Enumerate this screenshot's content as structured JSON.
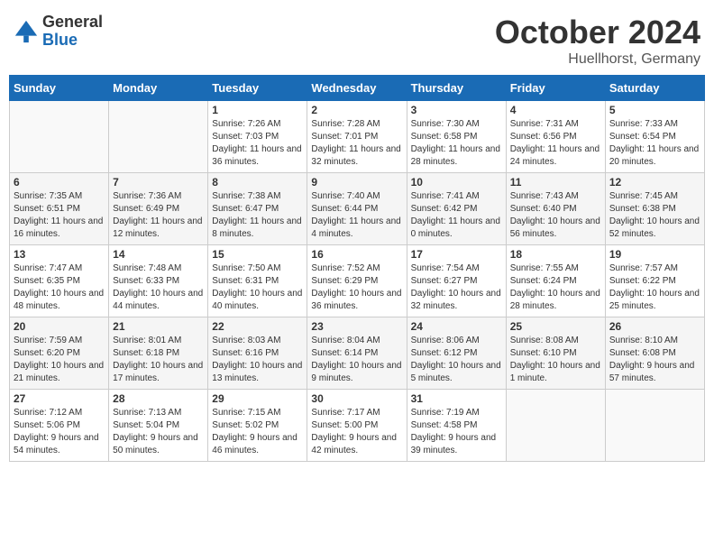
{
  "header": {
    "logo_general": "General",
    "logo_blue": "Blue",
    "title": "October 2024",
    "location": "Huellhorst, Germany"
  },
  "weekdays": [
    "Sunday",
    "Monday",
    "Tuesday",
    "Wednesday",
    "Thursday",
    "Friday",
    "Saturday"
  ],
  "weeks": [
    [
      {
        "day": "",
        "sunrise": "",
        "sunset": "",
        "daylight": ""
      },
      {
        "day": "",
        "sunrise": "",
        "sunset": "",
        "daylight": ""
      },
      {
        "day": "1",
        "sunrise": "Sunrise: 7:26 AM",
        "sunset": "Sunset: 7:03 PM",
        "daylight": "Daylight: 11 hours and 36 minutes."
      },
      {
        "day": "2",
        "sunrise": "Sunrise: 7:28 AM",
        "sunset": "Sunset: 7:01 PM",
        "daylight": "Daylight: 11 hours and 32 minutes."
      },
      {
        "day": "3",
        "sunrise": "Sunrise: 7:30 AM",
        "sunset": "Sunset: 6:58 PM",
        "daylight": "Daylight: 11 hours and 28 minutes."
      },
      {
        "day": "4",
        "sunrise": "Sunrise: 7:31 AM",
        "sunset": "Sunset: 6:56 PM",
        "daylight": "Daylight: 11 hours and 24 minutes."
      },
      {
        "day": "5",
        "sunrise": "Sunrise: 7:33 AM",
        "sunset": "Sunset: 6:54 PM",
        "daylight": "Daylight: 11 hours and 20 minutes."
      }
    ],
    [
      {
        "day": "6",
        "sunrise": "Sunrise: 7:35 AM",
        "sunset": "Sunset: 6:51 PM",
        "daylight": "Daylight: 11 hours and 16 minutes."
      },
      {
        "day": "7",
        "sunrise": "Sunrise: 7:36 AM",
        "sunset": "Sunset: 6:49 PM",
        "daylight": "Daylight: 11 hours and 12 minutes."
      },
      {
        "day": "8",
        "sunrise": "Sunrise: 7:38 AM",
        "sunset": "Sunset: 6:47 PM",
        "daylight": "Daylight: 11 hours and 8 minutes."
      },
      {
        "day": "9",
        "sunrise": "Sunrise: 7:40 AM",
        "sunset": "Sunset: 6:44 PM",
        "daylight": "Daylight: 11 hours and 4 minutes."
      },
      {
        "day": "10",
        "sunrise": "Sunrise: 7:41 AM",
        "sunset": "Sunset: 6:42 PM",
        "daylight": "Daylight: 11 hours and 0 minutes."
      },
      {
        "day": "11",
        "sunrise": "Sunrise: 7:43 AM",
        "sunset": "Sunset: 6:40 PM",
        "daylight": "Daylight: 10 hours and 56 minutes."
      },
      {
        "day": "12",
        "sunrise": "Sunrise: 7:45 AM",
        "sunset": "Sunset: 6:38 PM",
        "daylight": "Daylight: 10 hours and 52 minutes."
      }
    ],
    [
      {
        "day": "13",
        "sunrise": "Sunrise: 7:47 AM",
        "sunset": "Sunset: 6:35 PM",
        "daylight": "Daylight: 10 hours and 48 minutes."
      },
      {
        "day": "14",
        "sunrise": "Sunrise: 7:48 AM",
        "sunset": "Sunset: 6:33 PM",
        "daylight": "Daylight: 10 hours and 44 minutes."
      },
      {
        "day": "15",
        "sunrise": "Sunrise: 7:50 AM",
        "sunset": "Sunset: 6:31 PM",
        "daylight": "Daylight: 10 hours and 40 minutes."
      },
      {
        "day": "16",
        "sunrise": "Sunrise: 7:52 AM",
        "sunset": "Sunset: 6:29 PM",
        "daylight": "Daylight: 10 hours and 36 minutes."
      },
      {
        "day": "17",
        "sunrise": "Sunrise: 7:54 AM",
        "sunset": "Sunset: 6:27 PM",
        "daylight": "Daylight: 10 hours and 32 minutes."
      },
      {
        "day": "18",
        "sunrise": "Sunrise: 7:55 AM",
        "sunset": "Sunset: 6:24 PM",
        "daylight": "Daylight: 10 hours and 28 minutes."
      },
      {
        "day": "19",
        "sunrise": "Sunrise: 7:57 AM",
        "sunset": "Sunset: 6:22 PM",
        "daylight": "Daylight: 10 hours and 25 minutes."
      }
    ],
    [
      {
        "day": "20",
        "sunrise": "Sunrise: 7:59 AM",
        "sunset": "Sunset: 6:20 PM",
        "daylight": "Daylight: 10 hours and 21 minutes."
      },
      {
        "day": "21",
        "sunrise": "Sunrise: 8:01 AM",
        "sunset": "Sunset: 6:18 PM",
        "daylight": "Daylight: 10 hours and 17 minutes."
      },
      {
        "day": "22",
        "sunrise": "Sunrise: 8:03 AM",
        "sunset": "Sunset: 6:16 PM",
        "daylight": "Daylight: 10 hours and 13 minutes."
      },
      {
        "day": "23",
        "sunrise": "Sunrise: 8:04 AM",
        "sunset": "Sunset: 6:14 PM",
        "daylight": "Daylight: 10 hours and 9 minutes."
      },
      {
        "day": "24",
        "sunrise": "Sunrise: 8:06 AM",
        "sunset": "Sunset: 6:12 PM",
        "daylight": "Daylight: 10 hours and 5 minutes."
      },
      {
        "day": "25",
        "sunrise": "Sunrise: 8:08 AM",
        "sunset": "Sunset: 6:10 PM",
        "daylight": "Daylight: 10 hours and 1 minute."
      },
      {
        "day": "26",
        "sunrise": "Sunrise: 8:10 AM",
        "sunset": "Sunset: 6:08 PM",
        "daylight": "Daylight: 9 hours and 57 minutes."
      }
    ],
    [
      {
        "day": "27",
        "sunrise": "Sunrise: 7:12 AM",
        "sunset": "Sunset: 5:06 PM",
        "daylight": "Daylight: 9 hours and 54 minutes."
      },
      {
        "day": "28",
        "sunrise": "Sunrise: 7:13 AM",
        "sunset": "Sunset: 5:04 PM",
        "daylight": "Daylight: 9 hours and 50 minutes."
      },
      {
        "day": "29",
        "sunrise": "Sunrise: 7:15 AM",
        "sunset": "Sunset: 5:02 PM",
        "daylight": "Daylight: 9 hours and 46 minutes."
      },
      {
        "day": "30",
        "sunrise": "Sunrise: 7:17 AM",
        "sunset": "Sunset: 5:00 PM",
        "daylight": "Daylight: 9 hours and 42 minutes."
      },
      {
        "day": "31",
        "sunrise": "Sunrise: 7:19 AM",
        "sunset": "Sunset: 4:58 PM",
        "daylight": "Daylight: 9 hours and 39 minutes."
      },
      {
        "day": "",
        "sunrise": "",
        "sunset": "",
        "daylight": ""
      },
      {
        "day": "",
        "sunrise": "",
        "sunset": "",
        "daylight": ""
      }
    ]
  ]
}
